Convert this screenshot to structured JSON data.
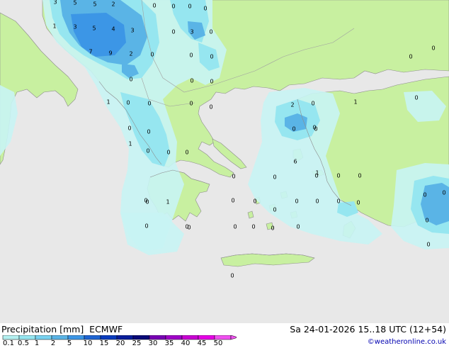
{
  "footer": {
    "product_label": "Precipitation [mm]",
    "model_label": "ECMWF",
    "datetime_label": "Sa 24-01-2026 15..18 UTC (12+54)",
    "credit": "©weatheronline.co.uk"
  },
  "legend": {
    "ticks": [
      "0.1",
      "0.5",
      "1",
      "2",
      "5",
      "10",
      "15",
      "20",
      "25",
      "30",
      "35",
      "40",
      "45",
      "50"
    ],
    "colors": [
      "#b4f0f0",
      "#96e6f0",
      "#78d2f0",
      "#5ab4e6",
      "#3c96e6",
      "#1e64d2",
      "#0a3cbe",
      "#0a1e9b",
      "#0a0a78",
      "#7800b4",
      "#a000c8",
      "#c800d2",
      "#e600e6",
      "#f050f0"
    ]
  },
  "colors": {
    "sea": "#e8e8e8",
    "land": "#c8f0a0",
    "precip_light": "#c8f4f4",
    "precip_mid": "#96e6f0",
    "precip_heavy": "#5ab4e6",
    "precip_heaviest": "#3c96e6"
  },
  "map_values": [
    {
      "t": "3"
    },
    {
      "t": "5"
    },
    {
      "t": "5"
    },
    {
      "t": "2"
    },
    {
      "t": "0"
    },
    {
      "t": "0"
    },
    {
      "t": "0"
    },
    {
      "t": "0"
    },
    {
      "t": "1"
    },
    {
      "t": "3"
    },
    {
      "t": "5"
    },
    {
      "t": "4"
    },
    {
      "t": "3"
    },
    {
      "t": "0"
    },
    {
      "t": "3"
    },
    {
      "t": "0"
    },
    {
      "t": "7"
    },
    {
      "t": "9"
    },
    {
      "t": "2"
    },
    {
      "t": "0"
    },
    {
      "t": "0"
    },
    {
      "t": "0"
    },
    {
      "t": "0"
    },
    {
      "t": "0"
    },
    {
      "t": "0"
    },
    {
      "t": "0"
    },
    {
      "t": "0"
    },
    {
      "t": "1"
    },
    {
      "t": "0"
    },
    {
      "t": "0"
    },
    {
      "t": "0"
    },
    {
      "t": "0"
    },
    {
      "t": "0"
    },
    {
      "t": "2"
    },
    {
      "t": "0"
    },
    {
      "t": "1"
    },
    {
      "t": "0"
    },
    {
      "t": "0"
    },
    {
      "t": "0"
    },
    {
      "t": "0"
    },
    {
      "t": "0"
    },
    {
      "t": "0"
    },
    {
      "t": "0"
    },
    {
      "t": "1"
    },
    {
      "t": "0"
    },
    {
      "t": "0"
    },
    {
      "t": "0"
    },
    {
      "t": "0"
    },
    {
      "t": "0"
    },
    {
      "t": "0"
    },
    {
      "t": "0"
    },
    {
      "t": "0"
    },
    {
      "t": "0"
    },
    {
      "t": "0"
    },
    {
      "t": "0"
    },
    {
      "t": "0"
    },
    {
      "t": "0"
    },
    {
      "t": "0"
    },
    {
      "t": "0"
    },
    {
      "t": "0"
    },
    {
      "t": "0"
    },
    {
      "t": "0"
    },
    {
      "t": "0"
    },
    {
      "t": "0"
    },
    {
      "t": "0"
    },
    {
      "t": "0"
    },
    {
      "t": "0"
    },
    {
      "t": "0"
    },
    {
      "t": "0"
    },
    {
      "t": "1"
    },
    {
      "t": "1"
    },
    {
      "t": "6"
    },
    {
      "t": "0"
    },
    {
      "t": "0"
    }
  ]
}
